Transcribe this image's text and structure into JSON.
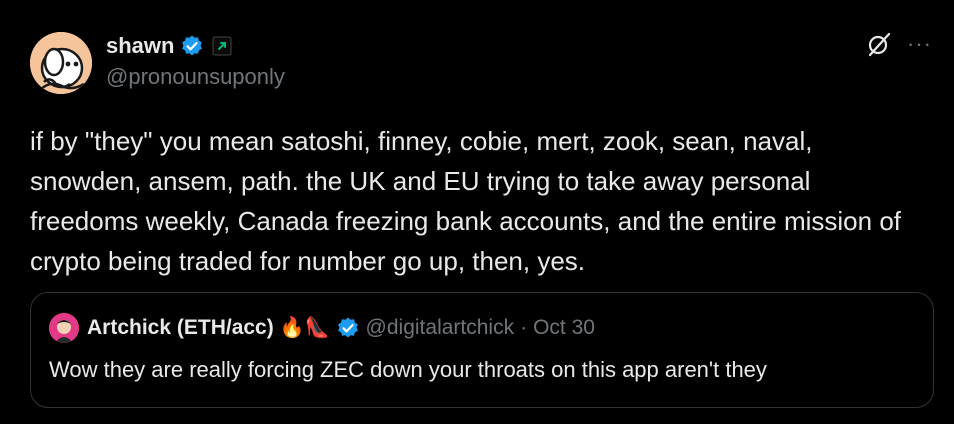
{
  "tweet": {
    "author": {
      "display_name": "shawn",
      "handle": "@pronounsuponly",
      "verified": true,
      "avatar_icon": "cartoon-character-avatar"
    },
    "text": "if by \"they\" you mean satoshi, finney, cobie, mert, zook, sean, naval, snowden, ansem, path. the UK and EU trying to take away personal freedoms weekly, Canada freezing bank accounts, and the entire mission of crypto being traded for number go up, then, yes.",
    "actions": {
      "grok_icon": "grok-icon",
      "more_label": "···"
    }
  },
  "quote": {
    "author": {
      "display_name": "Artchick (ETH/acc)",
      "emoji": "🔥👠",
      "handle": "@digitalartchick",
      "separator": "·",
      "date": "Oct 30",
      "verified": true
    },
    "text": "Wow they are really forcing ZEC down your throats on this app aren't they"
  },
  "colors": {
    "background": "#000000",
    "primary_text": "#e7e9ea",
    "secondary_text": "#71767b",
    "verified_blue": "#1d9bf0",
    "border": "#2f3336",
    "affiliate_green": "#00ba7c"
  }
}
